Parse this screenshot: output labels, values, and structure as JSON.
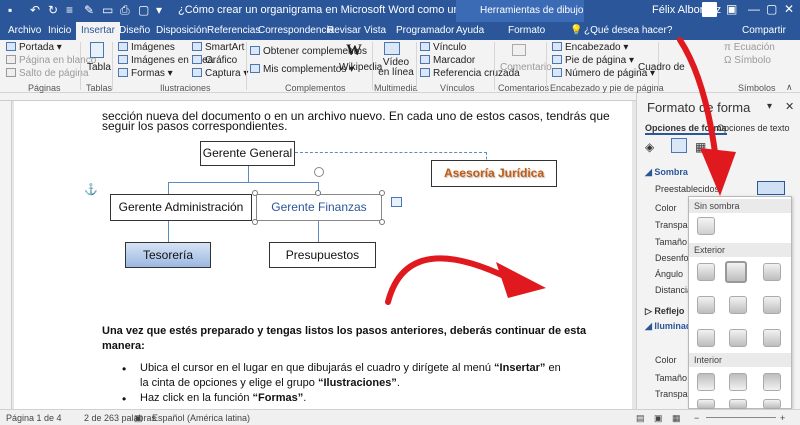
{
  "window": {
    "title": "¿Cómo crear un organigrama en Microsoft Word como un profesional  -  Word",
    "context_tab_group": "Herramientas de dibujo",
    "user": "Félix Albornoz"
  },
  "tabs": [
    "Archivo",
    "Inicio",
    "Insertar",
    "Diseño",
    "Disposición",
    "Referencias",
    "Correspondencia",
    "Revisar",
    "Vista",
    "Programador",
    "Ayuda",
    "Formato"
  ],
  "active_tab": "Insertar",
  "tell_me": "¿Qué desea hacer?",
  "share": "Compartir",
  "ribbon": {
    "paginas": {
      "label": "Páginas",
      "items": [
        "Portada",
        "Página en blanco",
        "Salto de página"
      ]
    },
    "tablas": {
      "label": "Tablas",
      "item": "Tabla"
    },
    "ilustraciones": {
      "label": "Ilustraciones",
      "items": [
        "Imágenes",
        "Imágenes en línea",
        "Formas",
        "SmartArt",
        "Gráfico",
        "Captura"
      ]
    },
    "complementos": {
      "label": "Complementos",
      "items": [
        "Obtener complementos",
        "Mis complementos",
        "Wikipedia"
      ]
    },
    "multimedia": {
      "label": "Multimedia",
      "item": "Vídeo en línea"
    },
    "vinculos": {
      "label": "Vínculos",
      "items": [
        "Vínculo",
        "Marcador",
        "Referencia cruzada"
      ]
    },
    "comentarios": {
      "label": "Comentarios",
      "item": "Comentario"
    },
    "encabezado": {
      "label": "Encabezado y pie de página",
      "items": [
        "Encabezado",
        "Pie de página",
        "Número de página"
      ]
    },
    "texto": {
      "item": "Cuadro de"
    },
    "simbolos": {
      "label": "Símbolos",
      "items": [
        "Ecuación",
        "Símbolo"
      ]
    }
  },
  "document": {
    "line1": "sección nueva del documento o en un archivo nuevo. En cada uno de estos casos, tendrás que",
    "line2": "seguir los pasos correspondientes.",
    "org": {
      "gerente_general": "Gerente General",
      "gerente_admin": "Gerente Administración",
      "gerente_finanzas": "Gerente Finanzas",
      "asesoria": "Asesoría Jurídica",
      "tesoreria": "Tesorería",
      "presupuestos": "Presupuestos"
    },
    "para_bold_1": "Una vez que estés preparado y tengas listos los pasos anteriores, deberás continuar de esta",
    "para_bold_2": "manera:",
    "bullet1_a": "Ubica el cursor en el lugar en que dibujarás el cuadro y dirígete al menú ",
    "bullet1_b": "“Insertar”",
    "bullet1_c": " en",
    "bullet1_d": "la cinta de opciones y elige el grupo ",
    "bullet1_e": "“Ilustraciones”",
    "bullet1_f": ".",
    "bullet2_a": "Haz click en la función ",
    "bullet2_b": "“Formas”",
    "bullet2_c": "."
  },
  "pane": {
    "title": "Formato de forma",
    "tab_shape": "Opciones de forma",
    "tab_text": "Opciones de texto",
    "sombra": "Sombra",
    "preestablecidos": "Preestablecidos",
    "props": [
      "Color",
      "Transparencia",
      "Tamaño",
      "Desenfoque",
      "Ángulo",
      "Distancia"
    ],
    "reflejo": "Reflejo",
    "iluminado": "Iluminado",
    "props2": [
      "Color",
      "Tamaño",
      "Transparencia"
    ]
  },
  "gallery": {
    "sin_sombra": "Sin sombra",
    "exterior": "Exterior",
    "interior": "Interior"
  },
  "status": {
    "page": "Página 1 de 4",
    "words": "2 de 263 palabras",
    "lang": "Español (América latina)"
  },
  "colors": {
    "accent": "#2b579a",
    "arrow": "#e0191f"
  }
}
